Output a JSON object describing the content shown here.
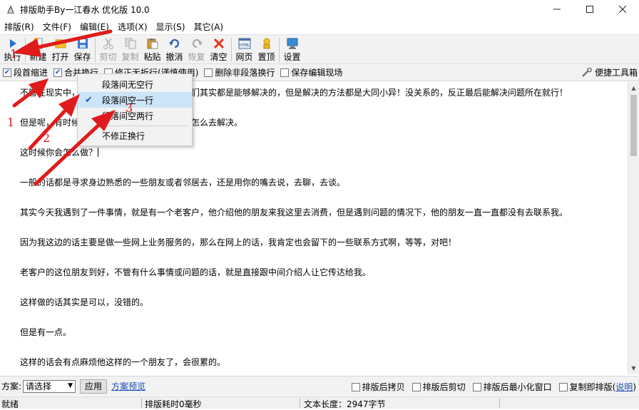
{
  "window": {
    "title": "排版助手By一江春水 优化版 10.0",
    "minimize_icon": "minimize-icon",
    "maximize_icon": "maximize-icon",
    "close_icon": "close-icon"
  },
  "menubar": {
    "items": [
      "排版(R)",
      "文件(F)",
      "编辑(E)",
      "选项(X)",
      "显示(S)",
      "其它(A)"
    ]
  },
  "toolbar": {
    "buttons": [
      {
        "label": "执行",
        "icon": "play-icon",
        "enabled": true
      },
      {
        "label": "新建",
        "icon": "new-file-icon",
        "enabled": true
      },
      {
        "label": "打开",
        "icon": "open-folder-icon",
        "enabled": true
      },
      {
        "label": "保存",
        "icon": "save-icon",
        "enabled": true
      },
      {
        "label": "剪切",
        "icon": "cut-icon",
        "enabled": false
      },
      {
        "label": "复制",
        "icon": "copy-icon",
        "enabled": false
      },
      {
        "label": "粘贴",
        "icon": "paste-icon",
        "enabled": true
      },
      {
        "label": "撤消",
        "icon": "undo-icon",
        "enabled": true
      },
      {
        "label": "恢复",
        "icon": "redo-icon",
        "enabled": false
      },
      {
        "label": "清空",
        "icon": "clear-icon",
        "enabled": true
      },
      {
        "label": "网页",
        "icon": "html-icon",
        "enabled": true
      },
      {
        "label": "置顶",
        "icon": "pin-icon",
        "enabled": true
      },
      {
        "label": "设置",
        "icon": "settings-monitor-icon",
        "enabled": true
      }
    ]
  },
  "options": {
    "indent": {
      "label": "段首缩进",
      "checked": true
    },
    "merge": {
      "label": "合并换行",
      "checked": true
    },
    "fix_hard": {
      "label": "修正无折行(谨慎使用)",
      "checked": false
    },
    "delete_nonpara": {
      "label": "删除非段落换行",
      "checked": false
    },
    "keep_edit": {
      "label": "保存编辑现场",
      "checked": false
    },
    "toolbox": {
      "label": "便捷工具箱",
      "icon": "wrench-icon"
    }
  },
  "dropdown": {
    "items": [
      {
        "label": "段落间无空行",
        "checked": false
      },
      {
        "label": "段落间空一行",
        "checked": true
      },
      {
        "label": "段落间空两行",
        "checked": false
      },
      {
        "label": "不修正换行",
        "checked": false
      }
    ]
  },
  "editor": {
    "paragraphs": [
      "不管在现实中，我们遇到了什么样的问题，我们其实都是能够解决的，但是解决的方法都是大同小异！没关系的，反正最后能解决问题所在就行！",
      "但是呢，有时候我们遇到了一些事情不知道该怎么去解决。",
      "这时候你会怎么做？",
      "一般的话都是寻求身边熟悉的一些朋友或者邻居去，还是用你的嘴去说，去聊，去谈。",
      "其实今天我遇到了一件事情，就是有一个老客户，他介绍他的朋友来我这里去消费，但是遇到问题的情况下，他的朋友一直一直都没有去联系我。",
      "因为我这边的话主要是做一些网上业务服务的，那么在网上的话，我肯定也会留下的一些联系方式啊，等等，对吧！",
      "老客户的这位朋友到好，不管有什么事情或问题的话，就是直接跟中间介绍人让它传达给我。",
      "这样做的话其实是可以，没错的。",
      "但是有一点。",
      "这样的话会有点麻烦他这样的一个朋友了，会很累的。"
    ]
  },
  "bottom": {
    "scheme_label": "方案:",
    "scheme_value": "请选择",
    "apply_label": "应用",
    "preview_label": "方案预览",
    "copy_after": {
      "label": "排版后拷贝",
      "checked": false
    },
    "cut_after": {
      "label": "排版后剪切",
      "checked": false
    },
    "minimize_after": {
      "label": "排版后最小化窗口",
      "checked": false
    },
    "copy_immediate": {
      "label": "复制即排版(",
      "checked": false
    },
    "help_link": "说明",
    "close_paren": ")"
  },
  "status": {
    "state": "就绪",
    "time": "排版耗时0毫秒",
    "length": "文本长度：2947字节"
  },
  "annotations": {
    "color": "#e01b1b",
    "labels": [
      "1",
      "2",
      "3"
    ]
  }
}
